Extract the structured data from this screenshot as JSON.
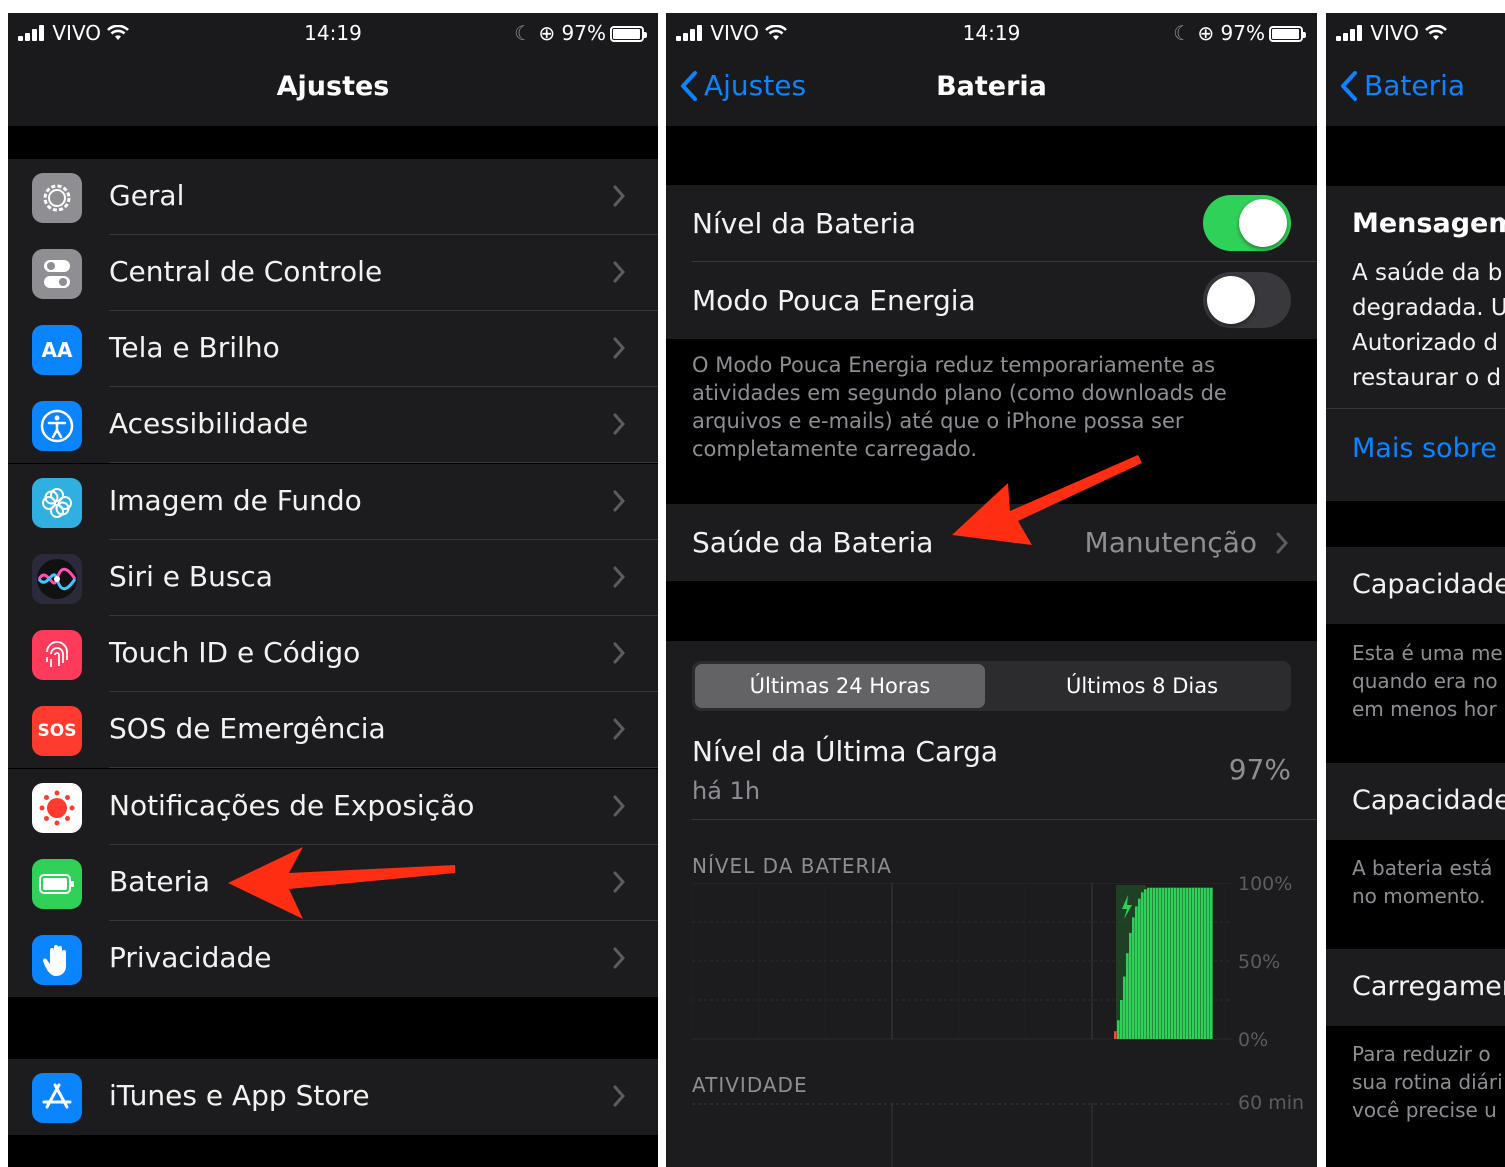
{
  "status_bar": {
    "carrier": "VIVO",
    "time": "14:19",
    "battery": "97%"
  },
  "settings": {
    "title": "Ajustes",
    "items": [
      {
        "label": "Geral",
        "icon": "gear-icon",
        "color": "#8e8e93"
      },
      {
        "label": "Central de Controle",
        "icon": "toggles-icon",
        "color": "#8e8e93"
      },
      {
        "label": "Tela e Brilho",
        "icon": "text-size-icon",
        "icon_text": "AA",
        "color": "#0a84ff"
      },
      {
        "label": "Acessibilidade",
        "icon": "accessibility-icon",
        "color": "#0a84ff"
      },
      {
        "label": "Imagem de Fundo",
        "icon": "flower-icon",
        "color": "#30b0e0"
      },
      {
        "label": "Siri e Busca",
        "icon": "siri-icon",
        "color": "#2a2a3a"
      },
      {
        "label": "Touch ID e Código",
        "icon": "fingerprint-icon",
        "color": "#ff3b5c"
      },
      {
        "label": "SOS de Emergência",
        "icon": "sos-icon",
        "icon_text": "SOS",
        "color": "#ff3b30"
      },
      {
        "label": "Notificações de Exposição",
        "icon": "exposure-icon",
        "color": "#ffffff"
      },
      {
        "label": "Bateria",
        "icon": "battery-icon",
        "color": "#30d158"
      },
      {
        "label": "Privacidade",
        "icon": "hand-icon",
        "color": "#0a84ff"
      },
      {
        "label": "iTunes e App Store",
        "icon": "app-store-icon",
        "color": "#0a84ff"
      }
    ]
  },
  "battery": {
    "back_label": "Ajustes",
    "title": "Bateria",
    "level_label": "Nível da Bateria",
    "low_power_label": "Modo Pouca Energia",
    "low_power_footer": "O Modo Pouca Energia reduz temporariamente as atividades em segundo plano (como downloads de arquivos e e-mails) até que o iPhone possa ser completamente carregado.",
    "health_label": "Saúde da Bateria",
    "health_value": "Manutenção",
    "seg_tabs": [
      "Últimas 24 Horas",
      "Últimos 8 Dias"
    ],
    "last_charge_label": "Nível da Última Carga",
    "last_charge_time": "há 1h",
    "last_charge_value": "97%",
    "chart_title": "NÍVEL DA BATERIA",
    "axis_100": "100%",
    "axis_50": "50%",
    "axis_0": "0%",
    "activity_label": "ATIVIDADE",
    "activity_axis": "60 min"
  },
  "chart_data": {
    "type": "bar",
    "title": "NÍVEL DA BATERIA",
    "ylim": [
      0,
      100
    ],
    "y_ticks": [
      "100%",
      "50%",
      "0%"
    ],
    "values": [
      5,
      12,
      25,
      40,
      55,
      68,
      78,
      85,
      90,
      94,
      96,
      97,
      97,
      97,
      97,
      97,
      97,
      97,
      97,
      97,
      97,
      97,
      97,
      97,
      97,
      97,
      97,
      97,
      97,
      97,
      97,
      97,
      97
    ]
  },
  "health_detail": {
    "back_label": "Bateria",
    "message_title": "Mensagem",
    "message_lines": [
      "A saúde da b",
      "degradada. U",
      "Autorizado d",
      "restaurar o d"
    ],
    "link": "Mais sobre",
    "capacity_title": "Capacidade",
    "capacity_lines": [
      "Esta é uma me",
      "quando era no",
      "em menos hor"
    ],
    "peak_title": "Capacidade",
    "peak_lines": [
      "A bateria está",
      "no momento."
    ],
    "charging_title": "Carregamen",
    "charging_lines": [
      "Para reduzir o",
      "sua rotina diári",
      "você precise u"
    ]
  }
}
